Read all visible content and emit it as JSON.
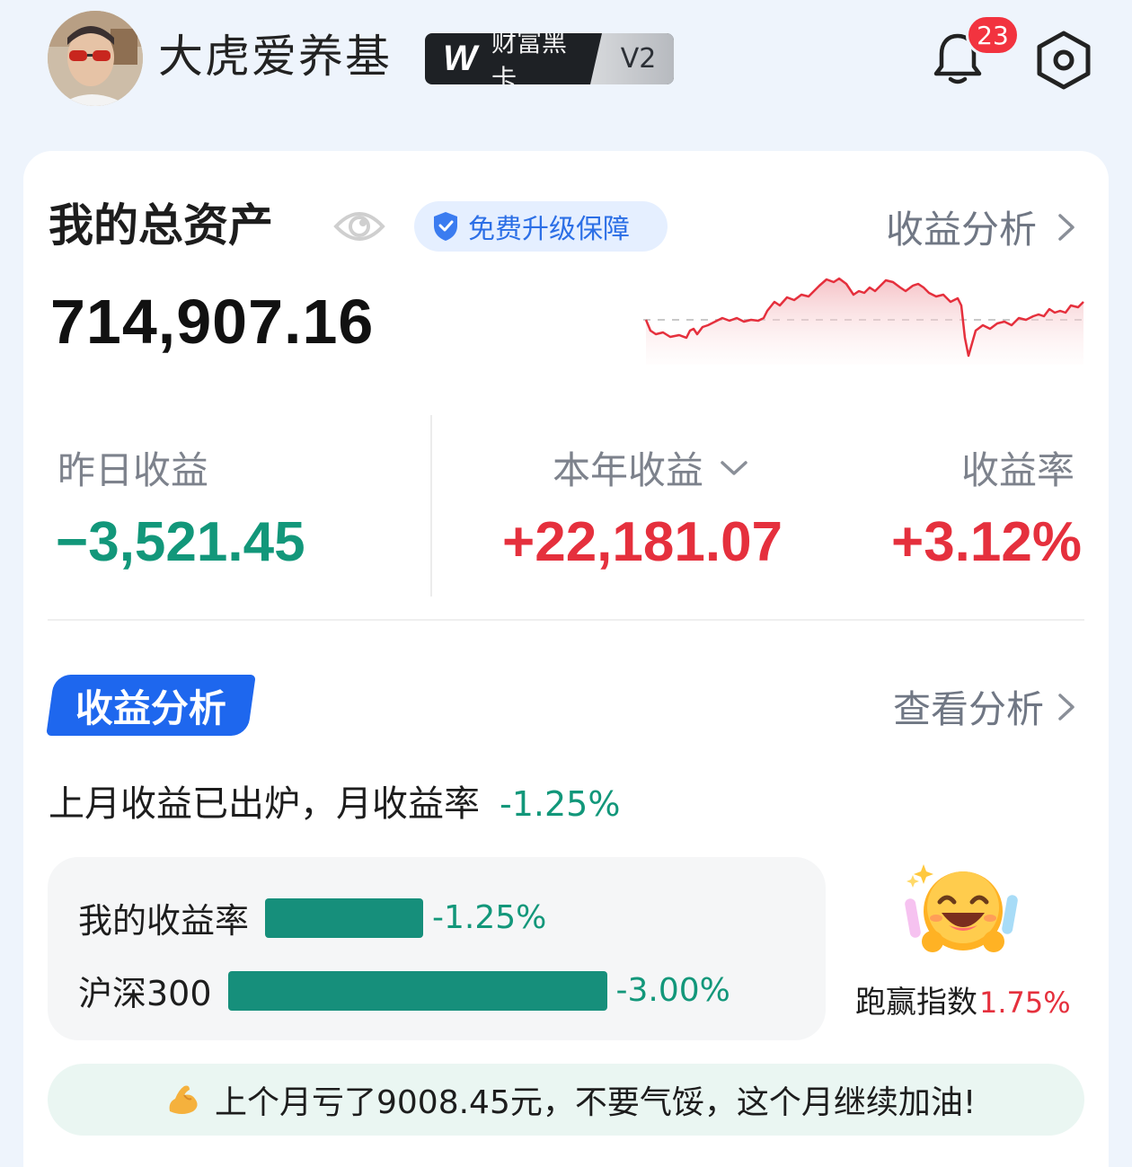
{
  "header": {
    "username": "大虎爱养基",
    "vip_badge": {
      "logo": "W",
      "text": "财富黑卡",
      "level": "V2"
    },
    "notification_count": "23",
    "icons": [
      "bell-icon",
      "settings-icon"
    ]
  },
  "assets": {
    "label": "我的总资产",
    "protect_label": "免费升级保障",
    "analysis_link": "收益分析",
    "total_value": "714,907.16"
  },
  "stats": {
    "yesterday_label": "昨日收益",
    "yesterday_value": "−3,521.45",
    "year_label": "本年收益",
    "year_value": "+22,181.07",
    "rate_label": "收益率",
    "rate_value": "+3.12%"
  },
  "analysis": {
    "tag": "收益分析",
    "view_link": "查看分析",
    "month_text": "上月收益已出炉，月收益率",
    "month_rate": "-1.25%",
    "rows": [
      {
        "name": "我的收益率",
        "value": "-1.25%",
        "rate": -1.25
      },
      {
        "name": "沪深300",
        "value": "-3.00%",
        "rate": -3.0
      }
    ],
    "beat_label": "跑赢指数",
    "beat_value": "1.75%",
    "tip": "上个月亏了9008.45元，不要气馁，这个月继续加油!"
  },
  "colors": {
    "up": "#e5303d",
    "down": "#12977a",
    "accent": "#1e67ee"
  }
}
